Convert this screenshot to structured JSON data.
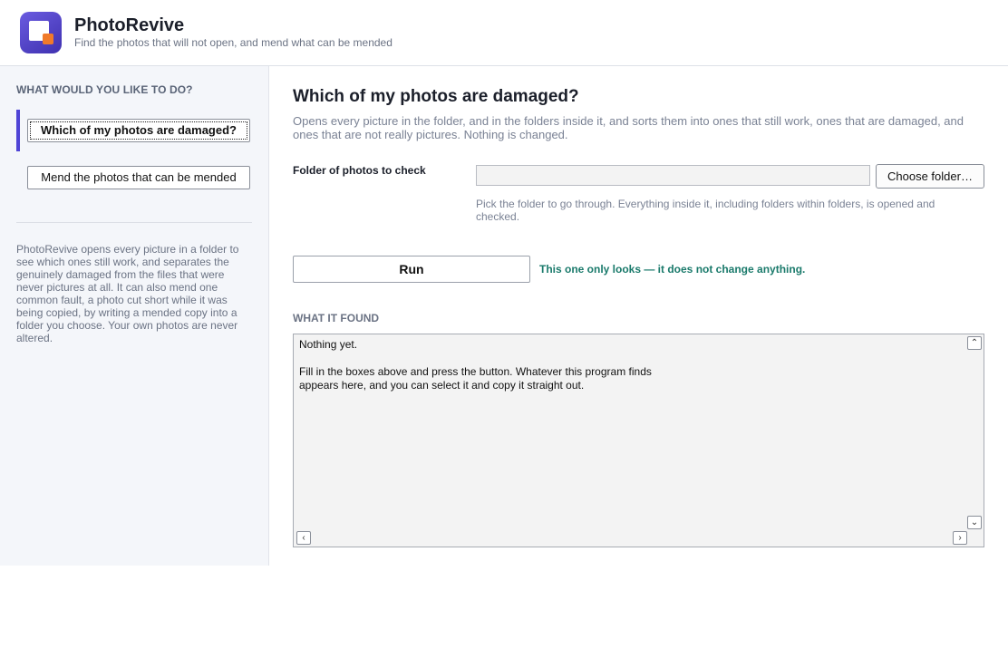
{
  "app": {
    "title": "PhotoRevive",
    "subtitle": "Find the photos that will not open, and mend what can be mended",
    "accent_color": "#4f44d6",
    "logo_icon": "photo-stack-icon"
  },
  "sidebar": {
    "heading": "WHAT WOULD YOU LIKE TO DO?",
    "items": [
      {
        "label": "Which of my photos are damaged?",
        "selected": true
      },
      {
        "label": "Mend the photos that can be mended",
        "selected": false
      }
    ],
    "about": "PhotoRevive opens every picture in a folder to see which ones still work, and separates the genuinely damaged from the files that were never pictures at all. It can also mend one common fault, a photo cut short while it was being copied, by writing a mended copy into a folder you choose. Your own photos are never altered."
  },
  "main": {
    "title": "Which of my photos are damaged?",
    "description": "Opens every picture in the folder, and in the folders inside it, and sorts them into ones that still work, ones that are damaged, and ones that are not really pictures. Nothing is changed.",
    "folder_field": {
      "label": "Folder of photos to check",
      "value": "",
      "choose_label": "Choose folder…",
      "help": "Pick the folder to go through. Everything inside it, including folders within folders, is opened and checked."
    },
    "run_label": "Run",
    "run_note": "This one only looks — it does not change anything.",
    "results": {
      "heading": "WHAT IT FOUND",
      "text": "Nothing yet.\n\nFill in the boxes above and press the button. Whatever this program finds\nappears here, and you can select it and copy it straight out.",
      "scroll_up": "⌃",
      "scroll_down": "⌄",
      "scroll_left": "‹",
      "scroll_right": "›"
    },
    "note_color": "#1a7a6b"
  }
}
